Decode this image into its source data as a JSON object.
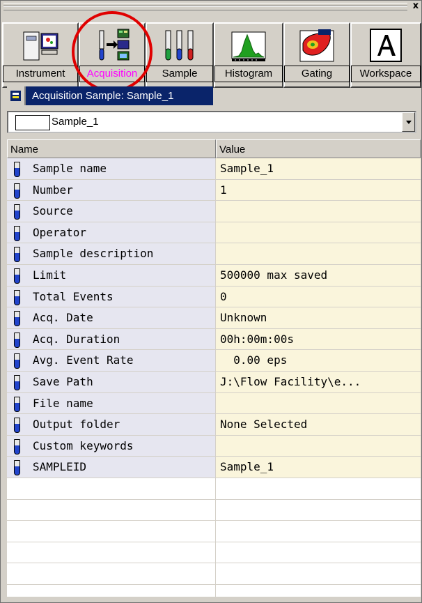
{
  "window": {
    "close_glyph": "x"
  },
  "toolbar": {
    "buttons": [
      {
        "label": "Instrument",
        "icon": "instrument-icon"
      },
      {
        "label": "Acquisition",
        "icon": "acquisition-icon",
        "active": true
      },
      {
        "label": "Sample",
        "icon": "sample-tubes-icon"
      },
      {
        "label": "Histogram",
        "icon": "histogram-icon"
      },
      {
        "label": "Gating",
        "icon": "gating-icon"
      },
      {
        "label": "Workspace",
        "icon": "workspace-icon"
      }
    ]
  },
  "panel": {
    "title": "Acquisition Sample: Sample_1",
    "selector_value": "Sample_1"
  },
  "grid": {
    "columns": [
      "Name",
      "Value"
    ],
    "rows": [
      {
        "name": "Sample name",
        "value": "Sample_1"
      },
      {
        "name": "Number",
        "value": "1"
      },
      {
        "name": "Source",
        "value": ""
      },
      {
        "name": "Operator",
        "value": ""
      },
      {
        "name": "Sample description",
        "value": ""
      },
      {
        "name": "Limit",
        "value": "500000 max saved"
      },
      {
        "name": "Total Events",
        "value": "0"
      },
      {
        "name": "Acq. Date",
        "value": "Unknown"
      },
      {
        "name": "Acq. Duration",
        "value": "00h:00m:00s"
      },
      {
        "name": "Avg. Event Rate",
        "value": "  0.00 eps"
      },
      {
        "name": "Save Path",
        "value": "J:\\Flow Facility\\e..."
      },
      {
        "name": "File name",
        "value": ""
      },
      {
        "name": "Output folder",
        "value": "None Selected"
      },
      {
        "name": "Custom keywords",
        "value": ""
      },
      {
        "name": "SAMPLEID",
        "value": "Sample_1"
      }
    ]
  },
  "colors": {
    "title_bar": "#0a246a",
    "active_label": "#ff00ff",
    "highlight_circle": "#e00000",
    "name_cell_bg": "#e6e6f0",
    "value_cell_bg": "#faf5dc"
  }
}
